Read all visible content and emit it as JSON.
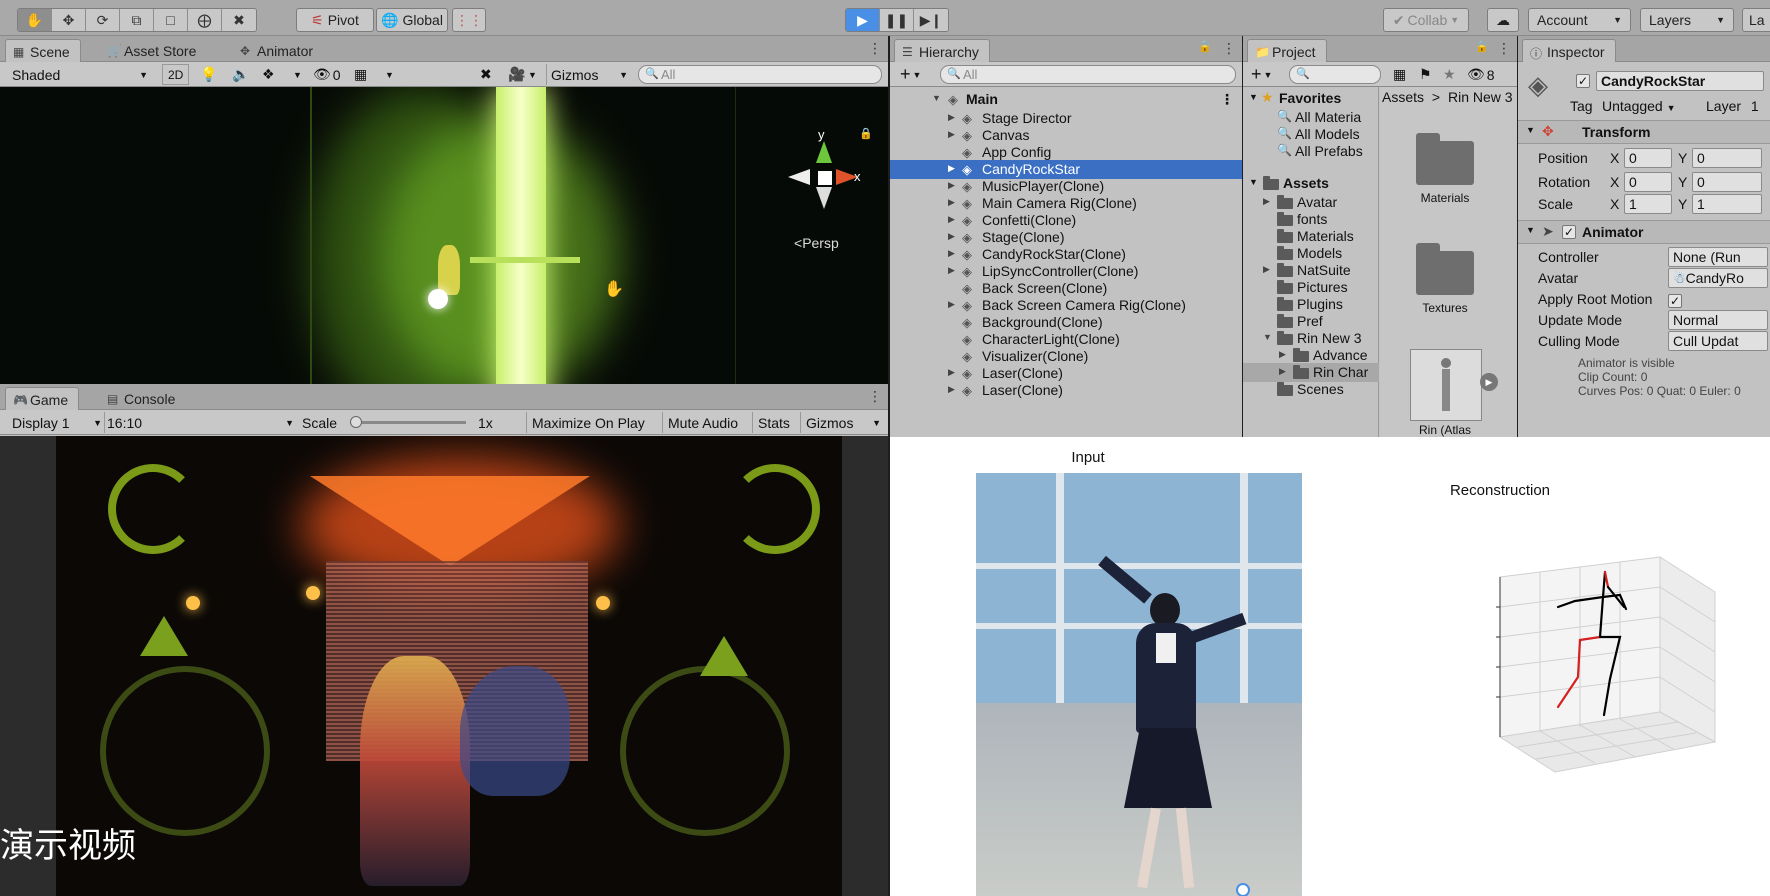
{
  "toolbar": {
    "tools": [
      "hand-tool-icon",
      "move-tool-icon",
      "rotate-tool-icon",
      "scale-tool-icon",
      "rect-tool-icon",
      "transform-tool-icon",
      "custom-tool-icon"
    ],
    "pivot_label": "Pivot",
    "global_label": "Global",
    "collab_label": "Collab",
    "account_label": "Account",
    "layers_label": "Layers",
    "layout_label": "La"
  },
  "scene": {
    "tabs": [
      "Scene",
      "Asset Store",
      "Animator"
    ],
    "shading_mode": "Shaded",
    "mode_2d": "2D",
    "hidden_count": "0",
    "gizmos_label": "Gizmos",
    "search_placeholder": "All",
    "persp_label": "Persp",
    "axis_y": "y",
    "axis_x": "x"
  },
  "game": {
    "tabs": [
      "Game",
      "Console"
    ],
    "display": "Display 1",
    "aspect": "16:10",
    "scale_label": "Scale",
    "scale_value": "1x",
    "scale_fraction": 0.05,
    "maximize_label": "Maximize On Play",
    "mute_label": "Mute Audio",
    "stats_label": "Stats",
    "gizmos_label": "Gizmos",
    "subtitle": "演示视频"
  },
  "hierarchy": {
    "tab": "Hierarchy",
    "search_placeholder": "All",
    "root": "Main",
    "items": [
      {
        "label": "Stage Director",
        "expandable": true
      },
      {
        "label": "Canvas",
        "expandable": true
      },
      {
        "label": "App Config",
        "expandable": false
      },
      {
        "label": "CandyRockStar",
        "expandable": true,
        "selected": true
      },
      {
        "label": "MusicPlayer(Clone)",
        "expandable": true
      },
      {
        "label": "Main Camera Rig(Clone)",
        "expandable": true
      },
      {
        "label": "Confetti(Clone)",
        "expandable": true
      },
      {
        "label": "Stage(Clone)",
        "expandable": true
      },
      {
        "label": "CandyRockStar(Clone)",
        "expandable": true
      },
      {
        "label": "LipSyncController(Clone)",
        "expandable": true
      },
      {
        "label": "Back Screen(Clone)",
        "expandable": false
      },
      {
        "label": "Back Screen Camera Rig(Clone)",
        "expandable": true
      },
      {
        "label": "Background(Clone)",
        "expandable": false
      },
      {
        "label": "CharacterLight(Clone)",
        "expandable": false
      },
      {
        "label": "Visualizer(Clone)",
        "expandable": false
      },
      {
        "label": "Laser(Clone)",
        "expandable": true
      },
      {
        "label": "Laser(Clone)",
        "expandable": true
      }
    ]
  },
  "project": {
    "tab": "Project",
    "hidden_count": "8",
    "favorites_label": "Favorites",
    "favorites": [
      "All Materia",
      "All Models",
      "All Prefabs"
    ],
    "assets_label": "Assets",
    "assets": [
      {
        "label": "Avatar",
        "expandable": true,
        "indent": 1
      },
      {
        "label": "fonts",
        "expandable": false,
        "indent": 1
      },
      {
        "label": "Materials",
        "expandable": false,
        "indent": 1
      },
      {
        "label": "Models",
        "expandable": false,
        "indent": 1
      },
      {
        "label": "NatSuite",
        "expandable": true,
        "indent": 1
      },
      {
        "label": "Pictures",
        "expandable": false,
        "indent": 1
      },
      {
        "label": "Plugins",
        "expandable": false,
        "indent": 1
      },
      {
        "label": "Pref",
        "expandable": false,
        "indent": 1
      },
      {
        "label": "Rin New 3",
        "expandable": true,
        "indent": 1,
        "open": true
      },
      {
        "label": "Advance",
        "expandable": true,
        "indent": 2
      },
      {
        "label": "Rin Char",
        "expandable": true,
        "indent": 2,
        "selected": true
      },
      {
        "label": "Scenes",
        "expandable": false,
        "indent": 1
      }
    ],
    "breadcrumb": [
      "Assets",
      "Rin New 3"
    ],
    "grid_items": [
      "Materials",
      "Textures",
      "Rin (Atlas"
    ]
  },
  "inspector": {
    "tab": "Inspector",
    "object_name": "CandyRockStar",
    "tag_label": "Tag",
    "tag_value": "Untagged",
    "layer_label": "Layer",
    "layer_value": "1",
    "transform_label": "Transform",
    "position_label": "Position",
    "rotation_label": "Rotation",
    "scale_label": "Scale",
    "position": {
      "x": "0",
      "y": "0"
    },
    "rotation": {
      "x": "0",
      "y": "0"
    },
    "scale": {
      "x": "1",
      "y": "1"
    },
    "animator_label": "Animator",
    "controller_label": "Controller",
    "controller_value": "None (Run",
    "avatar_label": "Avatar",
    "avatar_value": "CandyRo",
    "apply_root_motion_label": "Apply Root Motion",
    "update_mode_label": "Update Mode",
    "update_mode_value": "Normal",
    "culling_mode_label": "Culling Mode",
    "culling_mode_value": "Cull Updat",
    "info_line1": "Animator is visible",
    "info_line2": "Clip Count: 0",
    "info_line3": "Curves Pos: 0 Quat: 0 Euler: 0"
  },
  "figure": {
    "input_title": "Input",
    "reconstruction_title": "Reconstruction"
  },
  "colors": {
    "selection": "#3a6fc4",
    "play_button": "#4a8fe6",
    "skeleton_left": "#000000",
    "skeleton_right": "#d42020"
  }
}
